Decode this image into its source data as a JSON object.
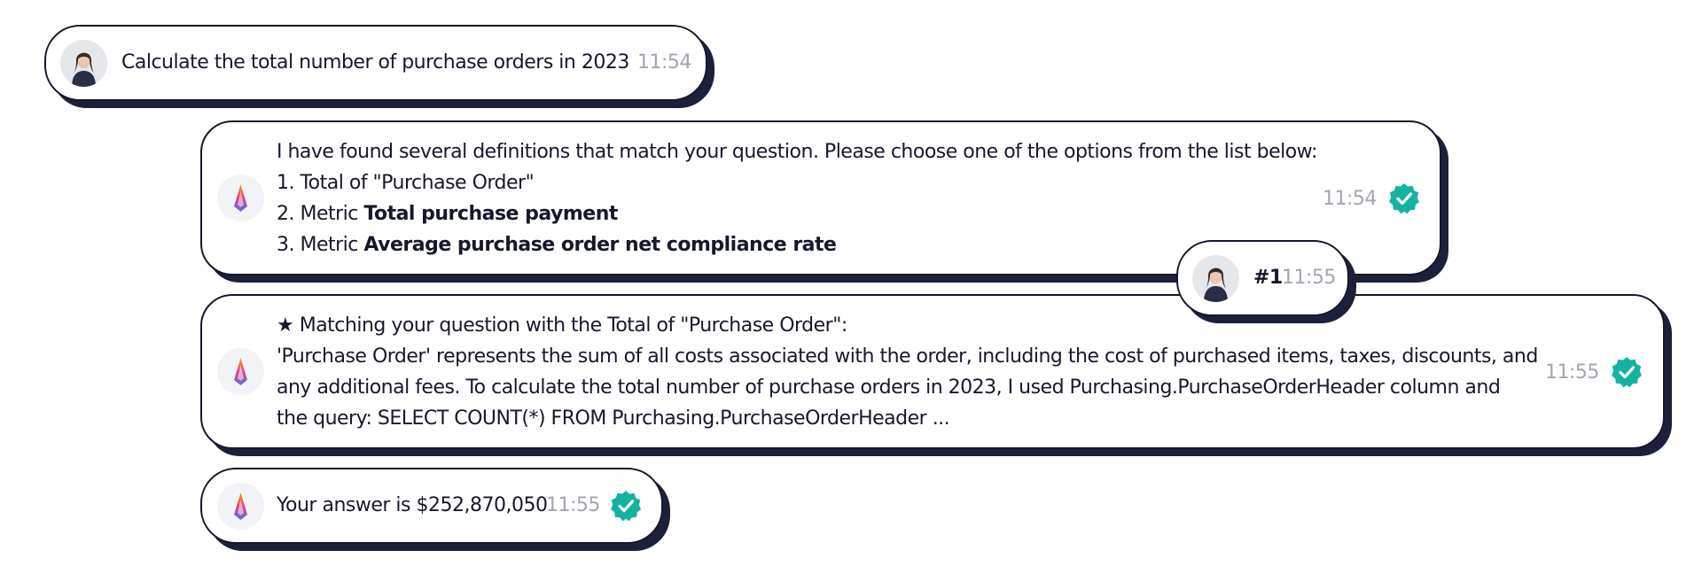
{
  "messages": {
    "user_question": {
      "text": "Calculate the total number of purchase orders in 2023",
      "time": "11:54"
    },
    "bot_options": {
      "intro": "I have found several definitions that match your question. Please choose one of the options from the list below:",
      "options": [
        {
          "prefix": "1. Total of \"Purchase Order\"",
          "bold": ""
        },
        {
          "prefix": "2. Metric ",
          "bold": "Total purchase payment"
        },
        {
          "prefix": "3. Metric ",
          "bold": "Average purchase order net compliance rate"
        }
      ],
      "time": "11:54",
      "status_icon": "verified-check-icon"
    },
    "user_choice": {
      "text": "#1",
      "time": "11:55"
    },
    "bot_explanation": {
      "lines": [
        "★ Matching your question with the  Total of \"Purchase Order\":",
        "'Purchase Order' represents the sum of all costs associated with the order, including the cost of purchased items, taxes, discounts, and",
        "any additional fees. To calculate the total number of purchase orders in 2023, I used Purchasing.PurchaseOrderHeader column and",
        "the query: SELECT COUNT(*) FROM Purchasing.PurchaseOrderHeader ..."
      ],
      "time": "11:55",
      "status_icon": "verified-check-icon"
    },
    "bot_answer": {
      "text": "Your answer is $252,870,050",
      "time": "11:55",
      "status_icon": "verified-check-icon"
    }
  },
  "colors": {
    "outline": "#16182b",
    "timestamp": "#a3a5b0",
    "verified": "#14b3a1"
  }
}
